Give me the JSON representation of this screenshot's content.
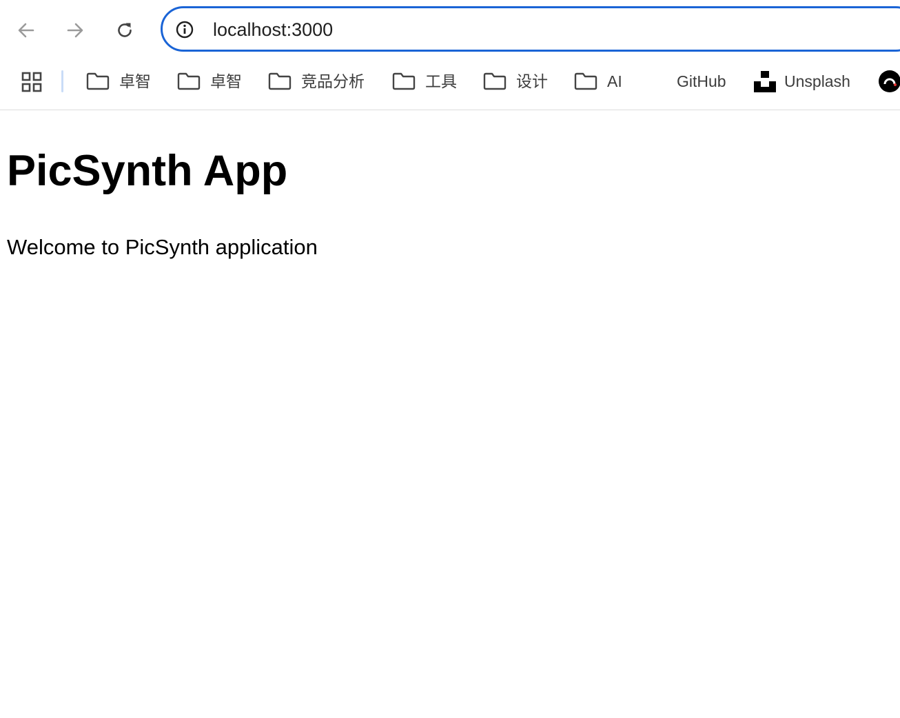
{
  "browser": {
    "url": "localhost:3000",
    "accent_color": "#1a64d6"
  },
  "bookmarks": [
    {
      "label": "卓智",
      "icon": "folder-icon"
    },
    {
      "label": "卓智",
      "icon": "folder-icon"
    },
    {
      "label": "竞品分析",
      "icon": "folder-icon"
    },
    {
      "label": "工具",
      "icon": "folder-icon"
    },
    {
      "label": "设计",
      "icon": "folder-icon"
    },
    {
      "label": "AI",
      "icon": "folder-icon"
    },
    {
      "label": "GitHub",
      "icon": "github-icon"
    },
    {
      "label": "Unsplash",
      "icon": "unsplash-icon"
    }
  ],
  "page": {
    "title": "PicSynth App",
    "text": "Welcome to PicSynth application"
  }
}
